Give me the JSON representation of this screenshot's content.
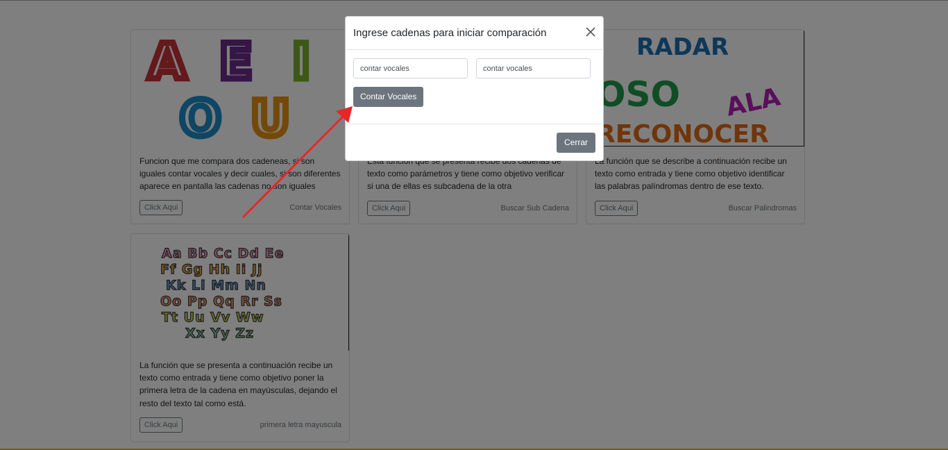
{
  "cards": [
    {
      "description": "Funcion que me compara dos cadeneas, si son iguales contar vocales y decir cuales, si son diferentes aparece en pantalla las cadenas no son iguales",
      "button_label": "Click Aqui",
      "meta": "Contar Vocales",
      "image_letters": [
        "A",
        "E",
        "I",
        "O",
        "U"
      ]
    },
    {
      "description": "Esta funcion que se presenta recibe dos cadenas de texto como parámetros y tiene como objetivo verificar si una de ellas es subcadena de la otra",
      "button_label": "Click Aqui",
      "meta": "Buscar Sub Cadena"
    },
    {
      "description": "La función que se describe a continuación recibe un texto como entrada y tiene como objetivo identificar las palabras palíndromas dentro de ese texto.",
      "button_label": "Click Aqui",
      "meta": "Buscar Palindromas",
      "image_words": [
        "RADAR",
        "OSO",
        "ALA",
        "RECONOCER"
      ]
    },
    {
      "description": "La función que se presenta a continuación recibe un texto como entrada y tiene como objetivo poner la primera letra de la cadena en mayúsculas, dejando el resto del texto tal como está.",
      "button_label": "Click Aqui",
      "meta": "primera letra mayuscula",
      "image_rows": [
        "Aa Bb Cc Dd Ee",
        "Ff Gg Hh Ii Jj",
        "Kk Ll Mm Nn",
        "Oo Pp Qq Rr Ss",
        "Tt Uu Vv Ww",
        "Xx Yy Zz"
      ]
    }
  ],
  "modal": {
    "title": "Ingrese cadenas para iniciar comparación",
    "input1_value": "contar vocales",
    "input2_value": "contar vocales",
    "submit_label": "Contar Vocales",
    "close_label": "Cerrar"
  },
  "colors": {
    "backdrop": "rgba(0,0,0,0.5)",
    "secondary": "#6c757d",
    "annotation_arrow": "#e8262a"
  }
}
